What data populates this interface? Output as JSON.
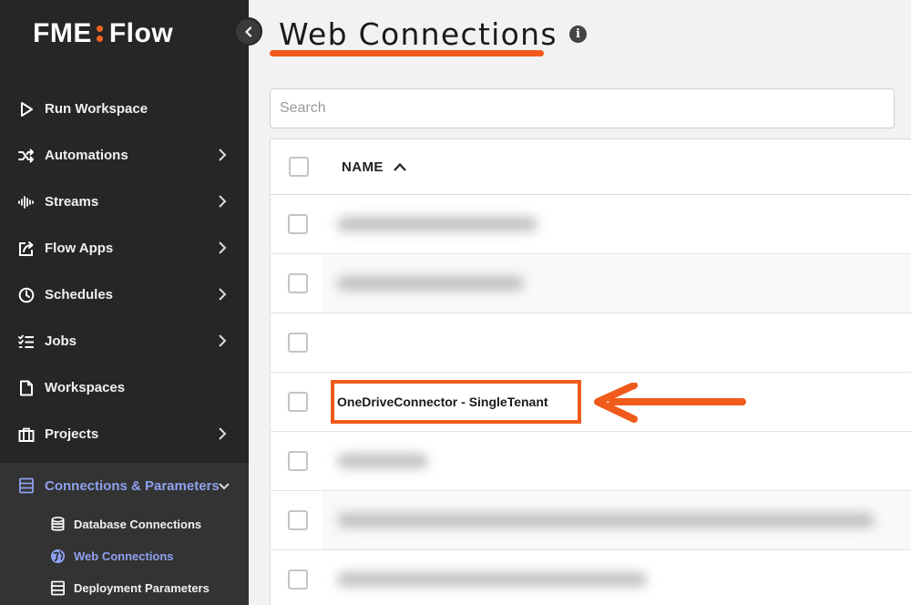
{
  "app": {
    "logo_left": "FME",
    "logo_right": "Flow"
  },
  "sidebar": {
    "items": [
      {
        "label": "Run Workspace",
        "icon": "play-icon",
        "chevron": false
      },
      {
        "label": "Automations",
        "icon": "shuffle-icon",
        "chevron": true
      },
      {
        "label": "Streams",
        "icon": "waveform-icon",
        "chevron": true
      },
      {
        "label": "Flow Apps",
        "icon": "share-icon",
        "chevron": true
      },
      {
        "label": "Schedules",
        "icon": "clock-icon",
        "chevron": true
      },
      {
        "label": "Jobs",
        "icon": "checklist-icon",
        "chevron": true
      },
      {
        "label": "Workspaces",
        "icon": "document-icon",
        "chevron": false
      },
      {
        "label": "Projects",
        "icon": "briefcase-icon",
        "chevron": true
      },
      {
        "label": "Connections & Parameters",
        "icon": "connections-icon",
        "chevron": true,
        "expanded": true,
        "active": true
      }
    ],
    "subitems": [
      {
        "label": "Database Connections",
        "icon": "database-icon"
      },
      {
        "label": "Web Connections",
        "icon": "globe-icon",
        "active": true
      },
      {
        "label": "Deployment Parameters",
        "icon": "parameters-icon"
      }
    ],
    "accent_color": "#8ea0ee"
  },
  "header": {
    "title": "Web Connections",
    "info_glyph": "i"
  },
  "search": {
    "placeholder": "Search",
    "value": ""
  },
  "table": {
    "columns": [
      {
        "label": "NAME",
        "sort": "ascending"
      }
    ],
    "rows": [
      {
        "name": "",
        "blurred": true
      },
      {
        "name": "",
        "blurred": true
      },
      {
        "name": "",
        "blurred": false
      },
      {
        "name": "OneDriveConnector - SingleTenant",
        "blurred": false,
        "highlighted": true
      },
      {
        "name": "",
        "blurred": true
      },
      {
        "name": "",
        "blurred": true
      },
      {
        "name": "",
        "blurred": true
      }
    ]
  },
  "annotation": {
    "color": "#f05a1a"
  }
}
